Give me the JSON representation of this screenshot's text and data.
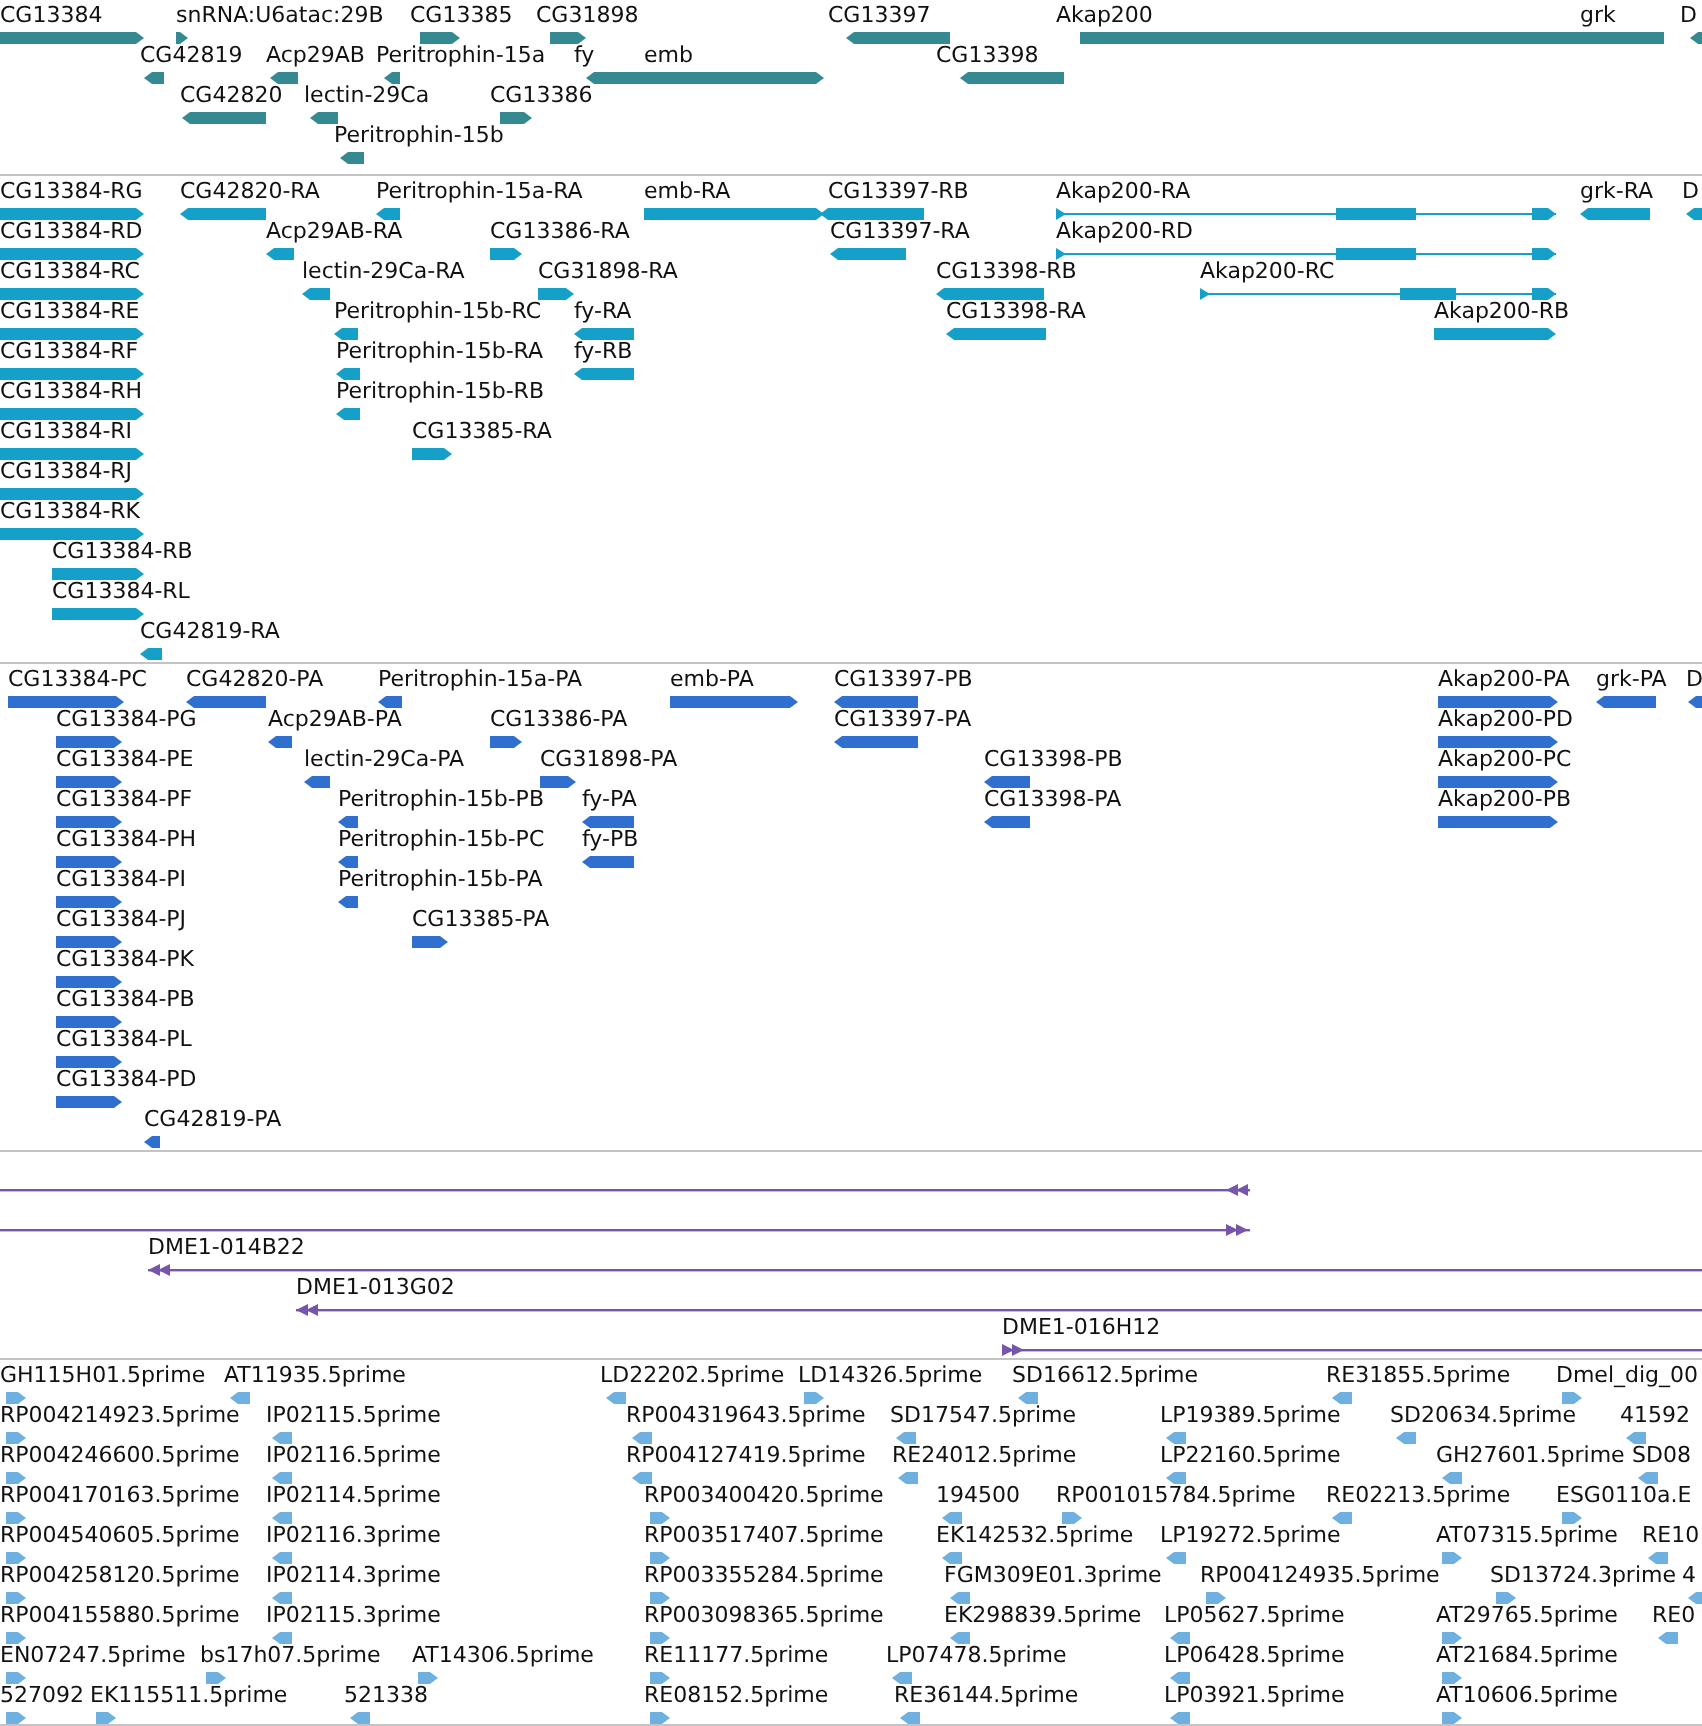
{
  "tracks": [
    {
      "kind": "gene",
      "rows": [
        {
          "features": [
            {
              "label": "CG13384",
              "reverse": false
            },
            {
              "label": "snRNA:U6atac:29B",
              "reverse": false
            },
            {
              "label": "CG13385",
              "reverse": false
            },
            {
              "label": "CG31898",
              "reverse": false
            },
            {
              "label": "CG13397",
              "reverse": true
            },
            {
              "label": "Akap200",
              "reverse": false
            },
            {
              "label": "grk",
              "reverse": true
            },
            {
              "label": "D",
              "reverse": true
            }
          ]
        },
        {
          "features": [
            {
              "label": "CG42819",
              "reverse": true
            },
            {
              "label": "Acp29AB",
              "reverse": true
            },
            {
              "label": "Peritrophin-15a",
              "reverse": true
            },
            {
              "label": "fy",
              "reverse": true
            },
            {
              "label": "emb",
              "reverse": false
            },
            {
              "label": "CG13398",
              "reverse": true
            }
          ]
        },
        {
          "features": [
            {
              "label": "CG42820",
              "reverse": true
            },
            {
              "label": "lectin-29Ca",
              "reverse": true
            },
            {
              "label": "CG13386",
              "reverse": false
            }
          ]
        },
        {
          "features": [
            {
              "label": "Peritrophin-15b",
              "reverse": true
            }
          ]
        }
      ]
    },
    {
      "kind": "transcript",
      "rows": [
        {
          "features": [
            {
              "label": "CG13384-RG",
              "reverse": false
            },
            {
              "label": "CG42820-RA",
              "reverse": true
            },
            {
              "label": "Peritrophin-15a-RA",
              "reverse": true
            },
            {
              "label": "emb-RA",
              "reverse": false
            },
            {
              "label": "CG13397-RB",
              "reverse": true
            },
            {
              "label": "Akap200-RA",
              "reverse": false
            },
            {
              "label": "grk-RA",
              "reverse": true
            },
            {
              "label": "D",
              "reverse": true
            }
          ]
        },
        {
          "features": [
            {
              "label": "CG13384-RD",
              "reverse": false
            },
            {
              "label": "Acp29AB-RA",
              "reverse": true
            },
            {
              "label": "CG13386-RA",
              "reverse": false
            },
            {
              "label": "CG13397-RA",
              "reverse": true
            },
            {
              "label": "Akap200-RD",
              "reverse": false
            }
          ]
        },
        {
          "features": [
            {
              "label": "CG13384-RC",
              "reverse": false
            },
            {
              "label": "lectin-29Ca-RA",
              "reverse": true
            },
            {
              "label": "CG31898-RA",
              "reverse": false
            },
            {
              "label": "CG13398-RB",
              "reverse": true
            },
            {
              "label": "Akap200-RC",
              "reverse": false
            }
          ]
        },
        {
          "features": [
            {
              "label": "CG13384-RE",
              "reverse": false
            },
            {
              "label": "Peritrophin-15b-RC",
              "reverse": true
            },
            {
              "label": "fy-RA",
              "reverse": true
            },
            {
              "label": "CG13398-RA",
              "reverse": true
            },
            {
              "label": "Akap200-RB",
              "reverse": false
            }
          ]
        },
        {
          "features": [
            {
              "label": "CG13384-RF",
              "reverse": false
            },
            {
              "label": "Peritrophin-15b-RA",
              "reverse": true
            },
            {
              "label": "fy-RB",
              "reverse": true
            }
          ]
        },
        {
          "features": [
            {
              "label": "CG13384-RH",
              "reverse": false
            },
            {
              "label": "Peritrophin-15b-RB",
              "reverse": true
            }
          ]
        },
        {
          "features": [
            {
              "label": "CG13384-RI",
              "reverse": false
            },
            {
              "label": "CG13385-RA",
              "reverse": false
            }
          ]
        },
        {
          "features": [
            {
              "label": "CG13384-RJ",
              "reverse": false
            }
          ]
        },
        {
          "features": [
            {
              "label": "CG13384-RK",
              "reverse": false
            }
          ]
        },
        {
          "features": [
            {
              "label": "CG13384-RB",
              "reverse": false
            }
          ]
        },
        {
          "features": [
            {
              "label": "CG13384-RL",
              "reverse": false
            }
          ]
        },
        {
          "features": [
            {
              "label": "CG42819-RA",
              "reverse": true
            }
          ]
        }
      ]
    },
    {
      "kind": "protein",
      "rows": [
        {
          "features": [
            {
              "label": "CG13384-PC",
              "reverse": false
            },
            {
              "label": "CG42820-PA",
              "reverse": true
            },
            {
              "label": "Peritrophin-15a-PA",
              "reverse": true
            },
            {
              "label": "emb-PA",
              "reverse": false
            },
            {
              "label": "CG13397-PB",
              "reverse": true
            },
            {
              "label": "Akap200-PA",
              "reverse": false
            },
            {
              "label": "grk-PA",
              "reverse": true
            },
            {
              "label": "D",
              "reverse": true
            }
          ]
        },
        {
          "features": [
            {
              "label": "CG13384-PG",
              "reverse": false
            },
            {
              "label": "Acp29AB-PA",
              "reverse": true
            },
            {
              "label": "CG13386-PA",
              "reverse": false
            },
            {
              "label": "CG13397-PA",
              "reverse": true
            },
            {
              "label": "Akap200-PD",
              "reverse": false
            }
          ]
        },
        {
          "features": [
            {
              "label": "CG13384-PE",
              "reverse": false
            },
            {
              "label": "lectin-29Ca-PA",
              "reverse": true
            },
            {
              "label": "CG31898-PA",
              "reverse": false
            },
            {
              "label": "CG13398-PB",
              "reverse": true
            },
            {
              "label": "Akap200-PC",
              "reverse": false
            }
          ]
        },
        {
          "features": [
            {
              "label": "CG13384-PF",
              "reverse": false
            },
            {
              "label": "Peritrophin-15b-PB",
              "reverse": true
            },
            {
              "label": "fy-PA",
              "reverse": true
            },
            {
              "label": "CG13398-PA",
              "reverse": true
            },
            {
              "label": "Akap200-PB",
              "reverse": false
            }
          ]
        },
        {
          "features": [
            {
              "label": "CG13384-PH",
              "reverse": false
            },
            {
              "label": "Peritrophin-15b-PC",
              "reverse": true
            },
            {
              "label": "fy-PB",
              "reverse": true
            }
          ]
        },
        {
          "features": [
            {
              "label": "CG13384-PI",
              "reverse": false
            },
            {
              "label": "Peritrophin-15b-PA",
              "reverse": true
            }
          ]
        },
        {
          "features": [
            {
              "label": "CG13384-PJ",
              "reverse": false
            },
            {
              "label": "CG13385-PA",
              "reverse": false
            }
          ]
        },
        {
          "features": [
            {
              "label": "CG13384-PK",
              "reverse": false
            }
          ]
        },
        {
          "features": [
            {
              "label": "CG13384-PB",
              "reverse": false
            }
          ]
        },
        {
          "features": [
            {
              "label": "CG13384-PL",
              "reverse": false
            }
          ]
        },
        {
          "features": [
            {
              "label": "CG13384-PD",
              "reverse": false
            }
          ]
        },
        {
          "features": [
            {
              "label": "CG42819-PA",
              "reverse": true
            }
          ]
        }
      ]
    },
    {
      "kind": "clone",
      "rows": [
        {
          "features": [
            {
              "reverse": true
            }
          ]
        },
        {
          "features": [
            {
              "reverse": false
            }
          ]
        },
        {
          "features": [
            {
              "label": "DME1-014B22",
              "reverse": true
            }
          ]
        },
        {
          "features": [
            {
              "label": "DME1-013G02",
              "reverse": true
            }
          ]
        },
        {
          "features": [
            {
              "label": "DME1-016H12",
              "reverse": false
            }
          ]
        }
      ]
    },
    {
      "kind": "est",
      "rows": [
        {
          "features": [
            {
              "label": "GH115H01.5prime",
              "reverse": false
            },
            {
              "label": "AT11935.5prime",
              "reverse": true
            },
            {
              "label": "LD22202.5prime",
              "reverse": true
            },
            {
              "label": "LD14326.5prime",
              "reverse": false
            },
            {
              "label": "SD16612.5prime",
              "reverse": true
            },
            {
              "label": "RE31855.5prime",
              "reverse": true
            },
            {
              "label": "Dmel_dig_00",
              "reverse": false
            }
          ]
        },
        {
          "features": [
            {
              "label": "RP004214923.5prime",
              "reverse": false
            },
            {
              "label": "IP02115.5prime",
              "reverse": true
            },
            {
              "label": "RP004319643.5prime",
              "reverse": true
            },
            {
              "label": "SD17547.5prime",
              "reverse": true
            },
            {
              "label": "LP19389.5prime",
              "reverse": true
            },
            {
              "label": "SD20634.5prime",
              "reverse": true
            },
            {
              "label": "41592",
              "reverse": true
            }
          ]
        },
        {
          "features": [
            {
              "label": "RP004246600.5prime",
              "reverse": false
            },
            {
              "label": "IP02116.5prime",
              "reverse": true
            },
            {
              "label": "RP004127419.5prime",
              "reverse": true
            },
            {
              "label": "RE24012.5prime",
              "reverse": true
            },
            {
              "label": "LP22160.5prime",
              "reverse": true
            },
            {
              "label": "GH27601.5prime",
              "reverse": true
            },
            {
              "label": "SD08",
              "reverse": true
            }
          ]
        },
        {
          "features": [
            {
              "label": "RP004170163.5prime",
              "reverse": false
            },
            {
              "label": "IP02114.5prime",
              "reverse": true
            },
            {
              "label": "RP003400420.5prime",
              "reverse": false
            },
            {
              "label": "194500",
              "reverse": true
            },
            {
              "label": "RP001015784.5prime",
              "reverse": false
            },
            {
              "label": "RE02213.5prime",
              "reverse": true
            },
            {
              "label": "ESG0110a.E",
              "reverse": false
            }
          ]
        },
        {
          "features": [
            {
              "label": "RP004540605.5prime",
              "reverse": false
            },
            {
              "label": "IP02116.3prime",
              "reverse": true
            },
            {
              "label": "RP003517407.5prime",
              "reverse": false
            },
            {
              "label": "EK142532.5prime",
              "reverse": true
            },
            {
              "label": "LP19272.5prime",
              "reverse": true
            },
            {
              "label": "AT07315.5prime",
              "reverse": false
            },
            {
              "label": "RE10",
              "reverse": true
            }
          ]
        },
        {
          "features": [
            {
              "label": "RP004258120.5prime",
              "reverse": false
            },
            {
              "label": "IP02114.3prime",
              "reverse": true
            },
            {
              "label": "RP003355284.5prime",
              "reverse": false
            },
            {
              "label": "FGM309E01.3prime",
              "reverse": true
            },
            {
              "label": "RP004124935.5prime",
              "reverse": false
            },
            {
              "label": "SD13724.3prime",
              "reverse": false
            },
            {
              "label": "4",
              "reverse": true
            }
          ]
        },
        {
          "features": [
            {
              "label": "RP004155880.5prime",
              "reverse": false
            },
            {
              "label": "IP02115.3prime",
              "reverse": true
            },
            {
              "label": "RP003098365.5prime",
              "reverse": false
            },
            {
              "label": "EK298839.5prime",
              "reverse": true
            },
            {
              "label": "LP05627.5prime",
              "reverse": true
            },
            {
              "label": "AT29765.5prime",
              "reverse": false
            },
            {
              "label": "RE0",
              "reverse": true
            }
          ]
        },
        {
          "features": [
            {
              "label": "EN07247.5prime",
              "reverse": false
            },
            {
              "label": "bs17h07.5prime",
              "reverse": false
            },
            {
              "label": "AT14306.5prime",
              "reverse": false
            },
            {
              "label": "RE11177.5prime",
              "reverse": false
            },
            {
              "label": "LP07478.5prime",
              "reverse": true
            },
            {
              "label": "LP06428.5prime",
              "reverse": true
            },
            {
              "label": "AT21684.5prime",
              "reverse": false
            }
          ]
        },
        {
          "features": [
            {
              "label": "527092",
              "reverse": false
            },
            {
              "label": "EK115511.5prime",
              "reverse": false
            },
            {
              "label": "521338",
              "reverse": true
            },
            {
              "label": "RE08152.5prime",
              "reverse": false
            },
            {
              "label": "RE36144.5prime",
              "reverse": true
            },
            {
              "label": "LP03921.5prime",
              "reverse": true
            },
            {
              "label": "AT10606.5prime",
              "reverse": false
            }
          ]
        }
      ]
    }
  ]
}
